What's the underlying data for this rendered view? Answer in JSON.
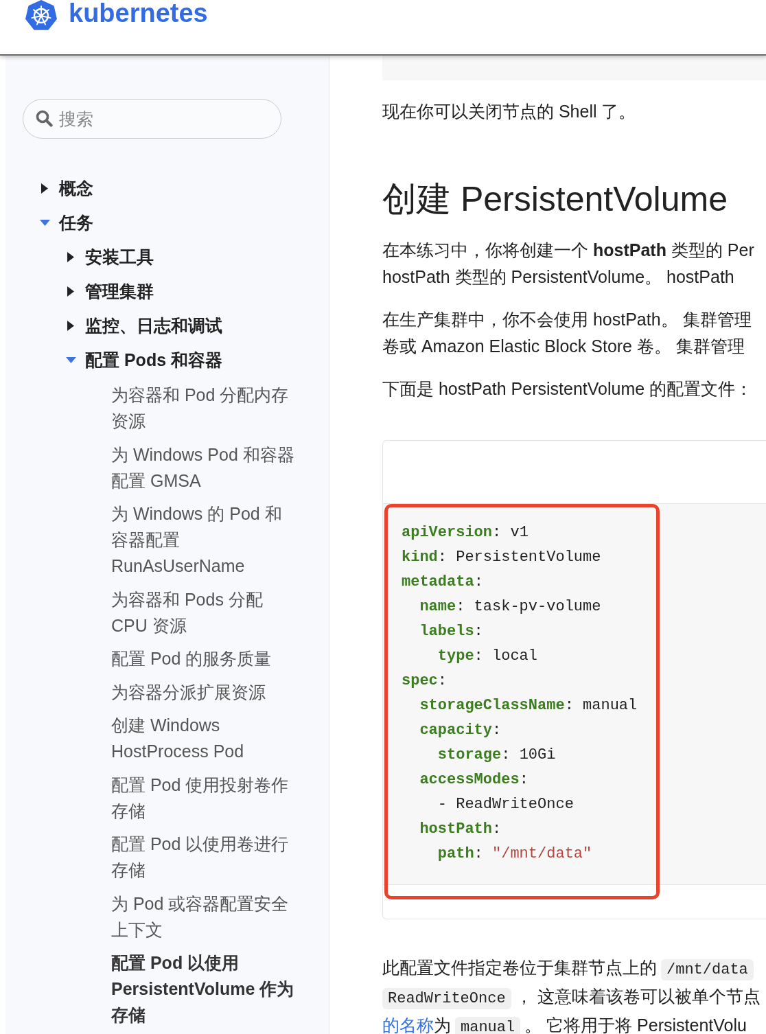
{
  "header": {
    "logo_text": "kubernetes"
  },
  "sidebar": {
    "search": {
      "placeholder": "搜索"
    },
    "nav": [
      {
        "kind": "section",
        "label": "概念",
        "expanded": false
      },
      {
        "kind": "section",
        "label": "任务",
        "expanded": true,
        "children": [
          {
            "kind": "section",
            "label": "安装工具",
            "expanded": false
          },
          {
            "kind": "section",
            "label": "管理集群",
            "expanded": false
          },
          {
            "kind": "section",
            "label": "监控、日志和调试",
            "expanded": false
          },
          {
            "kind": "section",
            "label": "配置 Pods 和容器",
            "expanded": true,
            "children": [
              {
                "kind": "page",
                "label": "为容器和 Pod 分配内存资源",
                "selected": false
              },
              {
                "kind": "page",
                "label": "为 Windows Pod 和容器配置 GMSA",
                "selected": false
              },
              {
                "kind": "page",
                "label": "为 Windows 的 Pod 和容器配置 RunAsUserName",
                "selected": false
              },
              {
                "kind": "page",
                "label": "为容器和 Pods 分配 CPU 资源",
                "selected": false
              },
              {
                "kind": "page",
                "label": "配置 Pod 的服务质量",
                "selected": false
              },
              {
                "kind": "page",
                "label": "为容器分派扩展资源",
                "selected": false
              },
              {
                "kind": "page",
                "label": "创建 Windows HostProcess Pod",
                "selected": false
              },
              {
                "kind": "page",
                "label": "配置 Pod 使用投射卷作存储",
                "selected": false
              },
              {
                "kind": "page",
                "label": "配置 Pod 以使用卷进行存储",
                "selected": false
              },
              {
                "kind": "page",
                "label": "为 Pod 或容器配置安全上下文",
                "selected": false
              },
              {
                "kind": "page",
                "label": "配置 Pod 以使用 PersistentVolume 作为存储",
                "selected": true
              }
            ]
          }
        ]
      }
    ]
  },
  "content": {
    "intro": "现在你可以关闭节点的 Shell 了。",
    "heading": "创建 PersistentVolume",
    "paragraphs": [
      {
        "lines": [
          "在本练习中，你将创建一个 **hostPath** 类型的 Per",
          "hostPath 类型的 PersistentVolume。 hostPath"
        ]
      },
      {
        "lines": [
          "在生产集群中，你不会使用 hostPath。 集群管理",
          "卷或 Amazon Elastic Block Store 卷。 集群管理"
        ]
      },
      {
        "lines": [
          "下面是 hostPath PersistentVolume 的配置文件："
        ]
      }
    ],
    "code_block": {
      "highlighted": true,
      "lines": [
        {
          "kind": "pair",
          "key": "apiVersion",
          "sep": ":",
          "value": {
            "kind": "scalar",
            "text": "v1"
          }
        },
        {
          "kind": "pair",
          "key": "kind",
          "sep": ":",
          "value": {
            "kind": "scalar",
            "text": "PersistentVolume"
          }
        },
        {
          "kind": "pair",
          "key": "metadata",
          "sep": ":",
          "children": [
            {
              "kind": "pair",
              "key": "name",
              "sep": ":",
              "value": {
                "kind": "scalar",
                "text": "task-pv-volume"
              }
            },
            {
              "kind": "pair",
              "key": "labels",
              "sep": ":",
              "children": [
                {
                  "kind": "pair",
                  "key": "type",
                  "sep": ":",
                  "value": {
                    "kind": "scalar",
                    "text": "local"
                  }
                }
              ]
            }
          ]
        },
        {
          "kind": "pair",
          "key": "spec",
          "sep": ":",
          "children": [
            {
              "kind": "pair",
              "key": "storageClassName",
              "sep": ":",
              "value": {
                "kind": "scalar",
                "text": "manual"
              }
            },
            {
              "kind": "pair",
              "key": "capacity",
              "sep": ":",
              "children": [
                {
                  "kind": "pair",
                  "key": "storage",
                  "sep": ":",
                  "value": {
                    "kind": "scalar",
                    "text": "10Gi"
                  }
                }
              ]
            },
            {
              "kind": "pair",
              "key": "accessModes",
              "sep": ":",
              "children": [
                {
                  "kind": "list-item",
                  "marker": "-",
                  "value": {
                    "kind": "scalar",
                    "text": "ReadWriteOnce"
                  }
                }
              ]
            },
            {
              "kind": "pair",
              "key": "hostPath",
              "sep": ":",
              "children": [
                {
                  "kind": "pair",
                  "key": "path",
                  "sep": ":",
                  "value": {
                    "kind": "string",
                    "text": "\"/mnt/data\""
                  }
                }
              ]
            }
          ]
        }
      ]
    },
    "note": {
      "lines": [
        [
          {
            "kind": "text",
            "text": "此配置文件指定卷位于集群节点上的"
          },
          {
            "kind": "code",
            "text": "/mnt/data"
          }
        ],
        [
          {
            "kind": "code",
            "text": "ReadWriteOnce"
          },
          {
            "kind": "text",
            "text": "， 这意味着该卷可以被单个节点"
          }
        ],
        [
          {
            "kind": "link",
            "text": "的名称"
          },
          {
            "kind": "text",
            "text": "为"
          },
          {
            "kind": "code",
            "text": "manual"
          },
          {
            "kind": "text",
            "text": "。 它将用于将 PersistentVolu"
          }
        ]
      ]
    }
  }
}
